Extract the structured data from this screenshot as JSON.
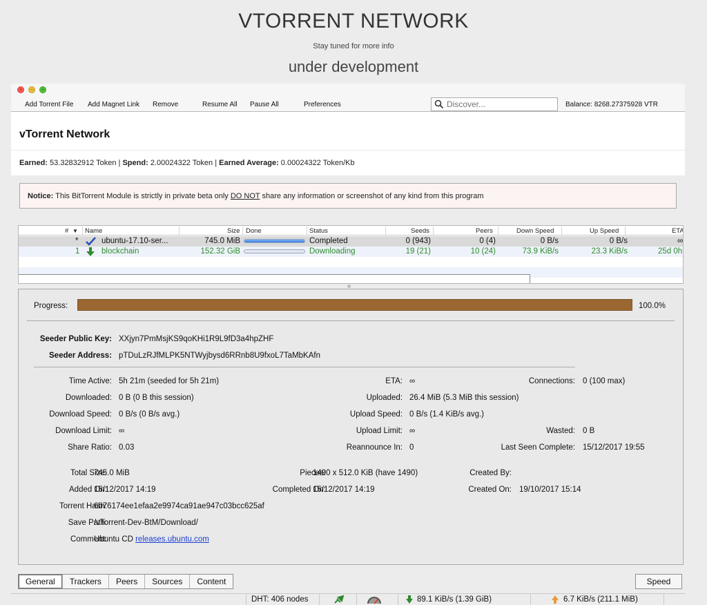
{
  "site": {
    "title": "VTORRENT NETWORK",
    "subtitle": "Stay tuned for more info",
    "status": "under development"
  },
  "toolbar": {
    "buttons": [
      "Add Torrent File",
      "Add Magnet Link",
      "Remove",
      "Resume All",
      "Pause All",
      "Preferences"
    ],
    "search_placeholder": "Discover...",
    "balance": "Balance: 8268.27375928 VTR"
  },
  "header": {
    "title": "vTorrent Network",
    "earned_label": "Earned:",
    "earned_value": "53.32832912 Token",
    "spend_label": "Spend:",
    "spend_value": "2.00024322 Token",
    "avg_label": "Earned Average:",
    "avg_value": "0.00024322 Token/Kb",
    "separator": "|"
  },
  "notice": {
    "label": "Notice:",
    "text_before": "This BitTorrent Module is strictly in private beta only",
    "emphasis": "DO NOT",
    "text_after": "share any information or screenshot of any kind from this program"
  },
  "torrent_list": {
    "columns": {
      "num": "#",
      "sort": "▼",
      "name": "Name",
      "size": "Size",
      "done": "Done",
      "status": "Status",
      "seeds": "Seeds",
      "peers": "Peers",
      "down_speed": "Down Speed",
      "up_speed": "Up Speed",
      "eta": "ETA"
    },
    "rows": [
      {
        "num": "*",
        "name": "ubuntu-17.10-ser...",
        "size": "745.0 MiB",
        "done_fraction": 1.0,
        "status": "Completed",
        "seeds": "0 (943)",
        "peers": "0 (4)",
        "down_speed": "0 B/s",
        "up_speed": "0 B/s",
        "eta": "∞"
      },
      {
        "num": "1",
        "name": "blockchain",
        "size": "152.32 GiB",
        "done_fraction": 0.0,
        "status": "Downloading",
        "seeds": "19 (21)",
        "peers": "10 (24)",
        "down_speed": "73.9 KiB/s",
        "up_speed": "23.3 KiB/s",
        "eta": "25d 0h"
      }
    ]
  },
  "details": {
    "progress_label": "Progress:",
    "progress_fraction": 1.0,
    "progress_text": "100.0%",
    "seeder_key_label": "Seeder Public Key:",
    "seeder_key": "XXjyn7PmMsjKS9qoKHi1R9L9fD3a4hpZHF",
    "seeder_addr_label": "Seeder Address:",
    "seeder_addr": "pTDuLzRJfMLPK5NTWyjbysd6RRnb8U9fxoL7TaMbKAfn",
    "time_active_label": "Time Active:",
    "time_active": "5h 21m (seeded for 5h 21m)",
    "downloaded_label": "Downloaded:",
    "downloaded": "0 B (0 B this session)",
    "down_speed_label": "Download Speed:",
    "down_speed": "0 B/s (0 B/s avg.)",
    "down_limit_label": "Download Limit:",
    "down_limit": "∞",
    "share_ratio_label": "Share Ratio:",
    "share_ratio": "0.03",
    "eta_label": "ETA:",
    "eta": "∞",
    "uploaded_label": "Uploaded:",
    "uploaded": "26.4 MiB (5.3 MiB this session)",
    "up_speed_label": "Upload Speed:",
    "up_speed": "0 B/s (1.4 KiB/s avg.)",
    "up_limit_label": "Upload Limit:",
    "up_limit": "∞",
    "reannounce_label": "Reannounce In:",
    "reannounce": "0",
    "connections_label": "Connections:",
    "connections": "0 (100 max)",
    "wasted_label": "Wasted:",
    "wasted": "0 B",
    "last_seen_label": "Last Seen Complete:",
    "last_seen": "15/12/2017  19:55",
    "total_size_label": "Total Size:",
    "total_size": "745.0 MiB",
    "added_on_label": "Added On:",
    "added_on": "15/12/2017  14:19",
    "pieces_label": "Pieces:",
    "pieces": "1490 x 512.0 KiB (have 1490)",
    "completed_on_label": "Completed On:",
    "completed_on": "15/12/2017  14:19",
    "created_by_label": "Created By:",
    "created_on_label": "Created On:",
    "created_on": "19/10/2017  15:14",
    "hash_label": "Torrent Hash:",
    "hash": "6b76174ee1efaa2e9974ca91ae947c03bcc625af",
    "save_path_label": "Save Path:",
    "save_path": "/vTorrent-Dev-BtM/Download/",
    "comment_label": "Comment:",
    "comment_text": "Ubuntu CD",
    "comment_link": "releases.ubuntu.com"
  },
  "tabs": [
    "General",
    "Trackers",
    "Peers",
    "Sources",
    "Content"
  ],
  "speed_button": "Speed",
  "statusbar": {
    "dht": "DHT: 406 nodes",
    "down": "89.1 KiB/s (1.39 GiB)",
    "up": "6.7 KiB/s (211.1 MiB)"
  },
  "colors": {
    "progress": "#9a6730",
    "downloading": "#2e8b2e",
    "link": "#1b3fd3"
  }
}
